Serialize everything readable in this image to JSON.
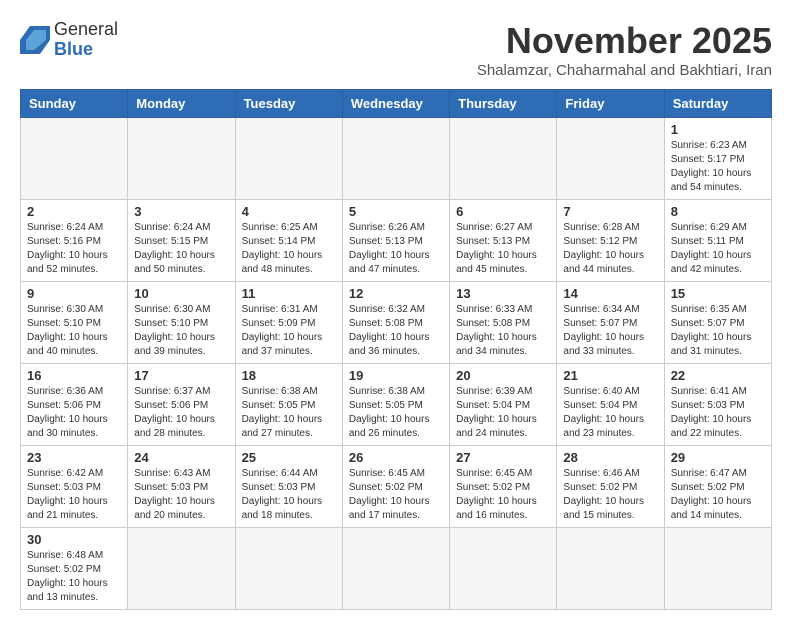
{
  "logo": {
    "line1": "General",
    "line2": "Blue"
  },
  "title": "November 2025",
  "subtitle": "Shalamzar, Chaharmahal and Bakhtiari, Iran",
  "weekdays": [
    "Sunday",
    "Monday",
    "Tuesday",
    "Wednesday",
    "Thursday",
    "Friday",
    "Saturday"
  ],
  "weeks": [
    [
      {
        "day": "",
        "info": ""
      },
      {
        "day": "",
        "info": ""
      },
      {
        "day": "",
        "info": ""
      },
      {
        "day": "",
        "info": ""
      },
      {
        "day": "",
        "info": ""
      },
      {
        "day": "",
        "info": ""
      },
      {
        "day": "1",
        "info": "Sunrise: 6:23 AM\nSunset: 5:17 PM\nDaylight: 10 hours\nand 54 minutes."
      }
    ],
    [
      {
        "day": "2",
        "info": "Sunrise: 6:24 AM\nSunset: 5:16 PM\nDaylight: 10 hours\nand 52 minutes."
      },
      {
        "day": "3",
        "info": "Sunrise: 6:24 AM\nSunset: 5:15 PM\nDaylight: 10 hours\nand 50 minutes."
      },
      {
        "day": "4",
        "info": "Sunrise: 6:25 AM\nSunset: 5:14 PM\nDaylight: 10 hours\nand 48 minutes."
      },
      {
        "day": "5",
        "info": "Sunrise: 6:26 AM\nSunset: 5:13 PM\nDaylight: 10 hours\nand 47 minutes."
      },
      {
        "day": "6",
        "info": "Sunrise: 6:27 AM\nSunset: 5:13 PM\nDaylight: 10 hours\nand 45 minutes."
      },
      {
        "day": "7",
        "info": "Sunrise: 6:28 AM\nSunset: 5:12 PM\nDaylight: 10 hours\nand 44 minutes."
      },
      {
        "day": "8",
        "info": "Sunrise: 6:29 AM\nSunset: 5:11 PM\nDaylight: 10 hours\nand 42 minutes."
      }
    ],
    [
      {
        "day": "9",
        "info": "Sunrise: 6:30 AM\nSunset: 5:10 PM\nDaylight: 10 hours\nand 40 minutes."
      },
      {
        "day": "10",
        "info": "Sunrise: 6:30 AM\nSunset: 5:10 PM\nDaylight: 10 hours\nand 39 minutes."
      },
      {
        "day": "11",
        "info": "Sunrise: 6:31 AM\nSunset: 5:09 PM\nDaylight: 10 hours\nand 37 minutes."
      },
      {
        "day": "12",
        "info": "Sunrise: 6:32 AM\nSunset: 5:08 PM\nDaylight: 10 hours\nand 36 minutes."
      },
      {
        "day": "13",
        "info": "Sunrise: 6:33 AM\nSunset: 5:08 PM\nDaylight: 10 hours\nand 34 minutes."
      },
      {
        "day": "14",
        "info": "Sunrise: 6:34 AM\nSunset: 5:07 PM\nDaylight: 10 hours\nand 33 minutes."
      },
      {
        "day": "15",
        "info": "Sunrise: 6:35 AM\nSunset: 5:07 PM\nDaylight: 10 hours\nand 31 minutes."
      }
    ],
    [
      {
        "day": "16",
        "info": "Sunrise: 6:36 AM\nSunset: 5:06 PM\nDaylight: 10 hours\nand 30 minutes."
      },
      {
        "day": "17",
        "info": "Sunrise: 6:37 AM\nSunset: 5:06 PM\nDaylight: 10 hours\nand 28 minutes."
      },
      {
        "day": "18",
        "info": "Sunrise: 6:38 AM\nSunset: 5:05 PM\nDaylight: 10 hours\nand 27 minutes."
      },
      {
        "day": "19",
        "info": "Sunrise: 6:38 AM\nSunset: 5:05 PM\nDaylight: 10 hours\nand 26 minutes."
      },
      {
        "day": "20",
        "info": "Sunrise: 6:39 AM\nSunset: 5:04 PM\nDaylight: 10 hours\nand 24 minutes."
      },
      {
        "day": "21",
        "info": "Sunrise: 6:40 AM\nSunset: 5:04 PM\nDaylight: 10 hours\nand 23 minutes."
      },
      {
        "day": "22",
        "info": "Sunrise: 6:41 AM\nSunset: 5:03 PM\nDaylight: 10 hours\nand 22 minutes."
      }
    ],
    [
      {
        "day": "23",
        "info": "Sunrise: 6:42 AM\nSunset: 5:03 PM\nDaylight: 10 hours\nand 21 minutes."
      },
      {
        "day": "24",
        "info": "Sunrise: 6:43 AM\nSunset: 5:03 PM\nDaylight: 10 hours\nand 20 minutes."
      },
      {
        "day": "25",
        "info": "Sunrise: 6:44 AM\nSunset: 5:03 PM\nDaylight: 10 hours\nand 18 minutes."
      },
      {
        "day": "26",
        "info": "Sunrise: 6:45 AM\nSunset: 5:02 PM\nDaylight: 10 hours\nand 17 minutes."
      },
      {
        "day": "27",
        "info": "Sunrise: 6:45 AM\nSunset: 5:02 PM\nDaylight: 10 hours\nand 16 minutes."
      },
      {
        "day": "28",
        "info": "Sunrise: 6:46 AM\nSunset: 5:02 PM\nDaylight: 10 hours\nand 15 minutes."
      },
      {
        "day": "29",
        "info": "Sunrise: 6:47 AM\nSunset: 5:02 PM\nDaylight: 10 hours\nand 14 minutes."
      }
    ],
    [
      {
        "day": "30",
        "info": "Sunrise: 6:48 AM\nSunset: 5:02 PM\nDaylight: 10 hours\nand 13 minutes."
      },
      {
        "day": "",
        "info": ""
      },
      {
        "day": "",
        "info": ""
      },
      {
        "day": "",
        "info": ""
      },
      {
        "day": "",
        "info": ""
      },
      {
        "day": "",
        "info": ""
      },
      {
        "day": "",
        "info": ""
      }
    ]
  ]
}
